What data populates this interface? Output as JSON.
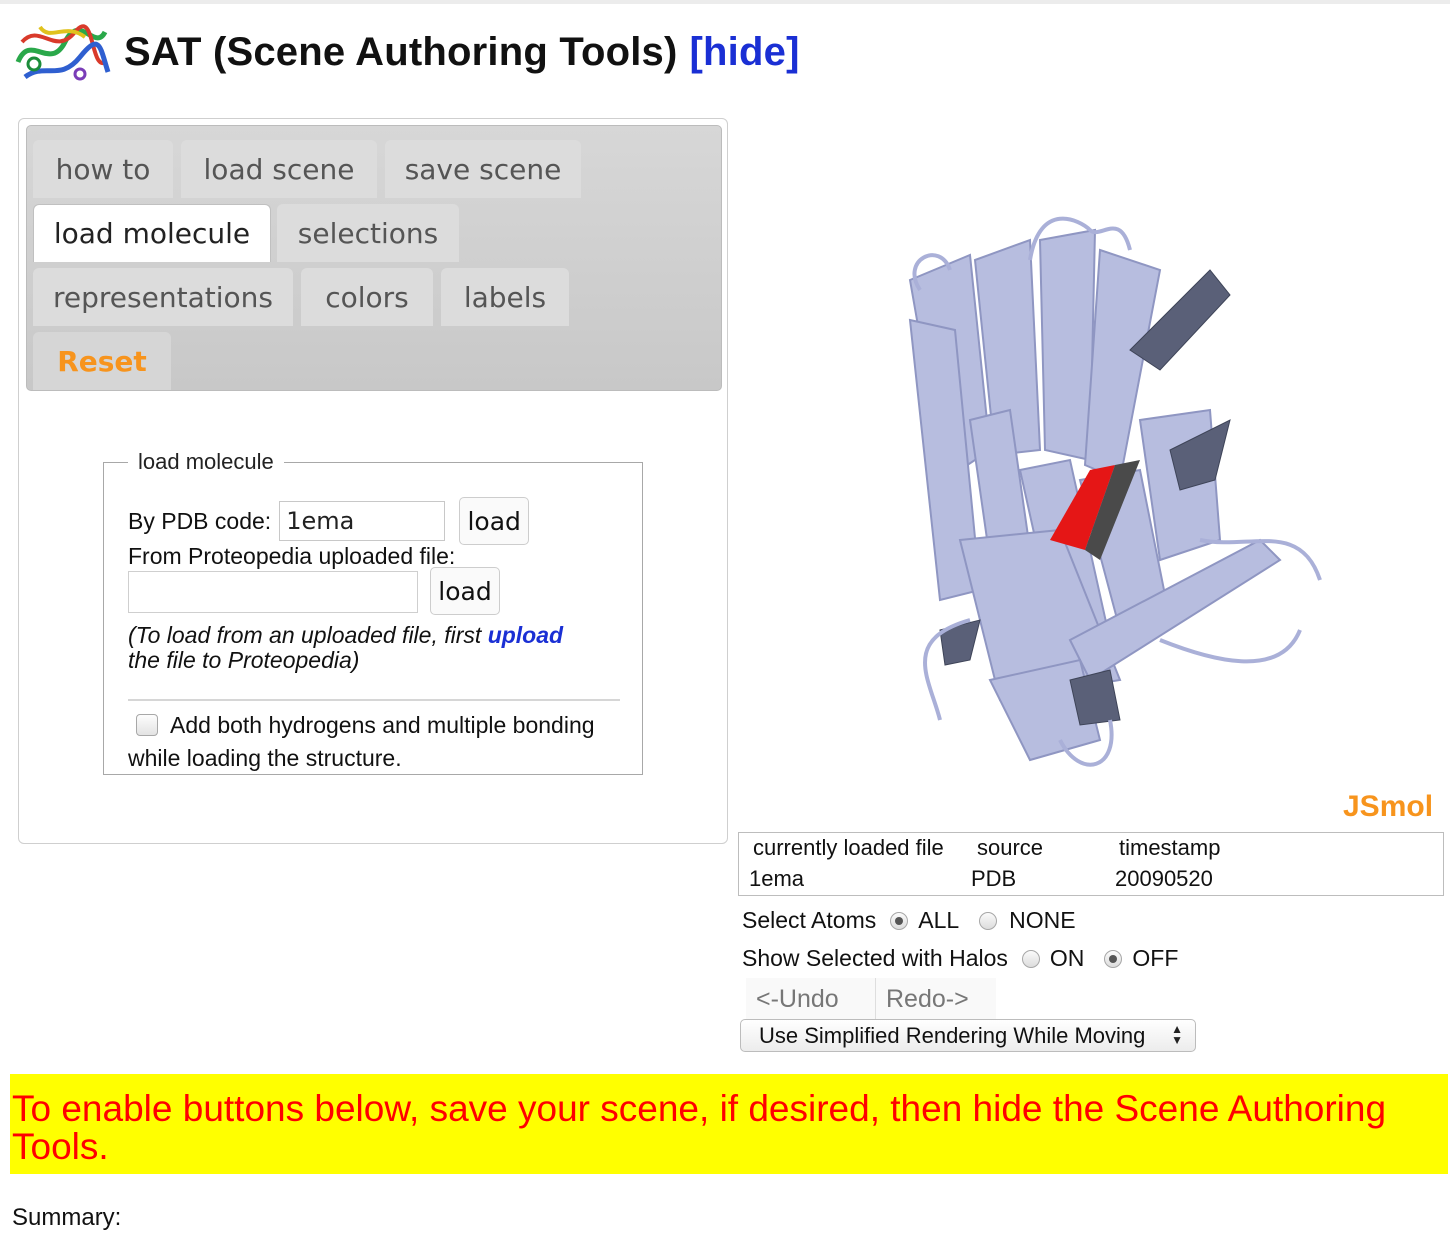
{
  "header": {
    "title": "SAT (Scene Authoring Tools)",
    "hide_link": "[hide]",
    "logo_icon": "protein-ribbon-logo-icon"
  },
  "tabs": [
    {
      "label": "how to"
    },
    {
      "label": "load scene"
    },
    {
      "label": "save scene"
    },
    {
      "label": "load molecule",
      "active": true
    },
    {
      "label": "selections"
    },
    {
      "label": "representations"
    },
    {
      "label": "colors"
    },
    {
      "label": "labels"
    },
    {
      "label": "Reset"
    }
  ],
  "load_molecule": {
    "legend": "load molecule",
    "pdb_label": "By PDB code:",
    "pdb_value": "1ema",
    "load_button": "load",
    "uploaded_label": "From Proteopedia uploaded file:",
    "uploaded_value": "",
    "load_button_2": "load",
    "note_prefix": "(To load from an uploaded file, first ",
    "note_link": "upload",
    "note_suffix": " the file to Proteopedia)",
    "hydrogens_checkbox_checked": false,
    "hydrogens_label": "Add both hydrogens and multiple bonding while loading the structure."
  },
  "viewer": {
    "brand": "JSmol",
    "brand_color": "#f7941d"
  },
  "file_info": {
    "headers": [
      "currently loaded file",
      "source",
      "timestamp"
    ],
    "values": [
      "1ema",
      "PDB",
      "20090520"
    ]
  },
  "controls": {
    "select_atoms_label": "Select Atoms",
    "select_all": "ALL",
    "select_none": "NONE",
    "select_atoms_value": "ALL",
    "halos_label": "Show Selected with Halos",
    "halos_on": "ON",
    "halos_off": "OFF",
    "halos_value": "OFF",
    "undo": "<-Undo",
    "redo": "Redo->",
    "rendering_select": "Use Simplified Rendering While Moving"
  },
  "banner": {
    "text": "To enable buttons below, save your scene, if desired, then hide the Scene Authoring Tools.",
    "background": "#ffff00",
    "color": "#ff0000"
  },
  "summary_label": "Summary:"
}
